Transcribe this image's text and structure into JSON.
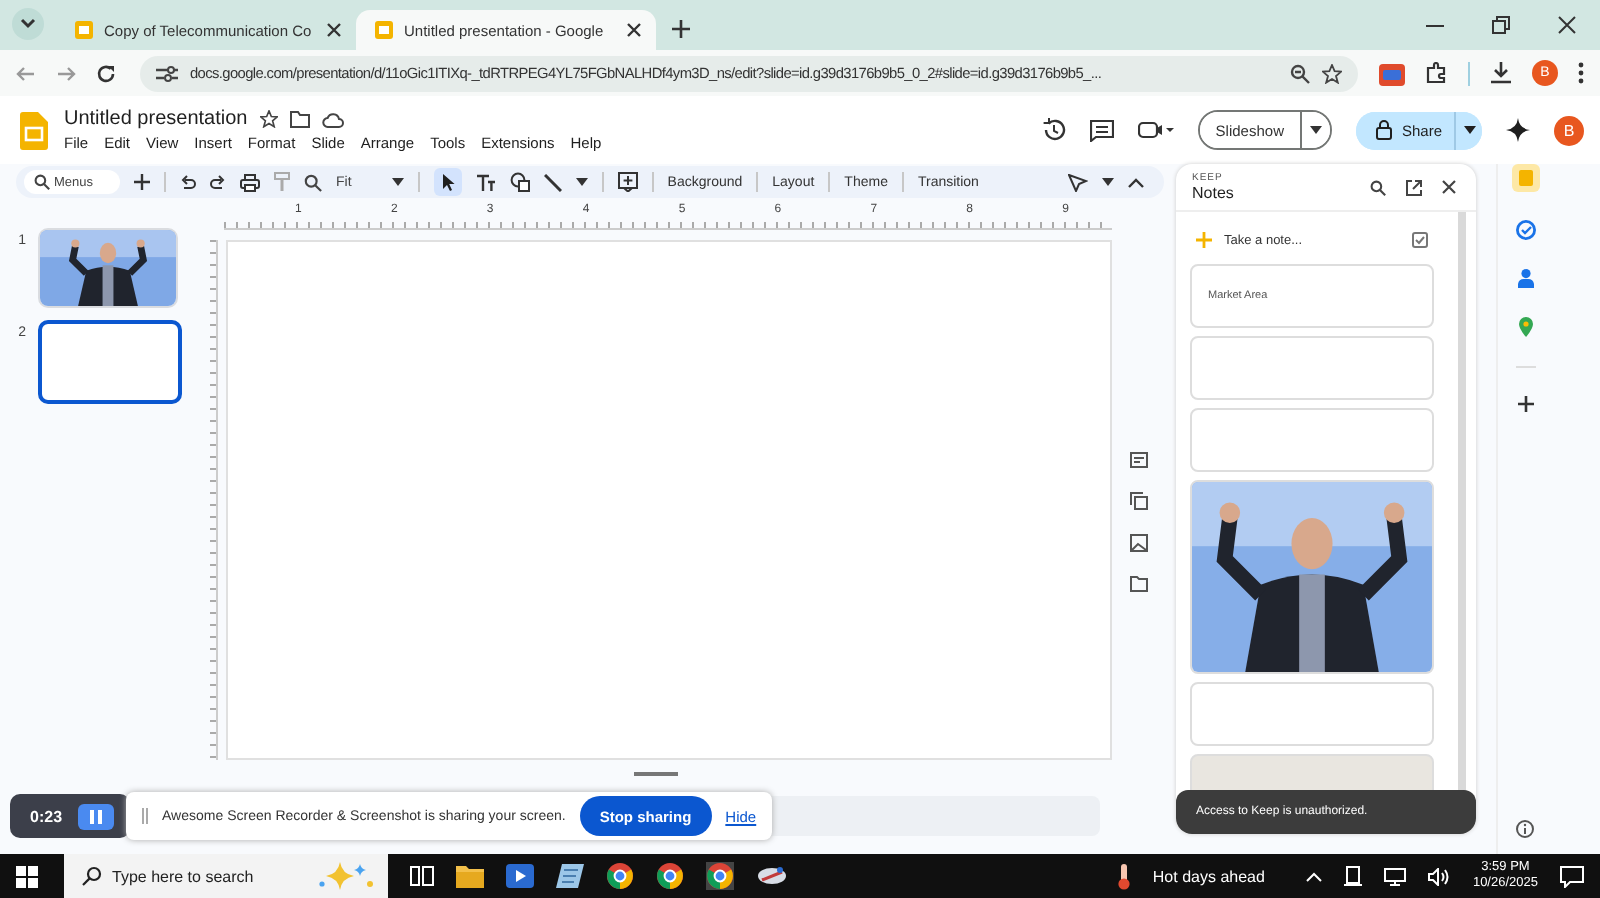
{
  "browser": {
    "tabs": [
      {
        "title": "Copy of Telecommunication Co",
        "selected": false
      },
      {
        "title": "Untitled presentation - Google",
        "selected": true
      }
    ],
    "url": "docs.google.com/presentation/d/11oGic1ITIXq-_tdRTRPEG4YL75FGbNALHDf4ym3D_ns/edit?slide=id.g39d3176b9b5_0_2#slide=id.g39d3176b9b5_...",
    "profile": "B"
  },
  "docs": {
    "title": "Untitled presentation",
    "menu": [
      "File",
      "Edit",
      "View",
      "Insert",
      "Format",
      "Slide",
      "Arrange",
      "Tools",
      "Extensions",
      "Help"
    ],
    "toolbar": {
      "search_placeholder": "Menus",
      "zoom": "Fit",
      "buttons": [
        "Background",
        "Layout",
        "Theme",
        "Transition"
      ]
    },
    "slideshow": "Slideshow",
    "share": "Share",
    "avatar": "B"
  },
  "ruler": [
    "1",
    "2",
    "3",
    "4",
    "5",
    "6",
    "7",
    "8",
    "9"
  ],
  "slides": [
    {
      "number": "1",
      "kind": "picture",
      "selected": false
    },
    {
      "number": "2",
      "kind": "blank",
      "selected": true
    }
  ],
  "keep": {
    "brand": "KEEP",
    "title": "Notes",
    "take_note": "Take a note...",
    "notes": [
      {
        "kind": "text",
        "text": "Market Area"
      },
      {
        "kind": "blank"
      },
      {
        "kind": "blank"
      },
      {
        "kind": "picture"
      },
      {
        "kind": "blank"
      },
      {
        "kind": "partial"
      }
    ],
    "toast": "Access to Keep is unauthorized."
  },
  "recorder": {
    "time": "0:23",
    "message": "Awesome Screen Recorder & Screenshot is sharing your screen.",
    "stop": "Stop sharing",
    "hide": "Hide"
  },
  "taskbar": {
    "search_placeholder": "Type here to search",
    "weather": "Hot days ahead",
    "time": "3:59 PM",
    "date": "10/26/2025"
  }
}
